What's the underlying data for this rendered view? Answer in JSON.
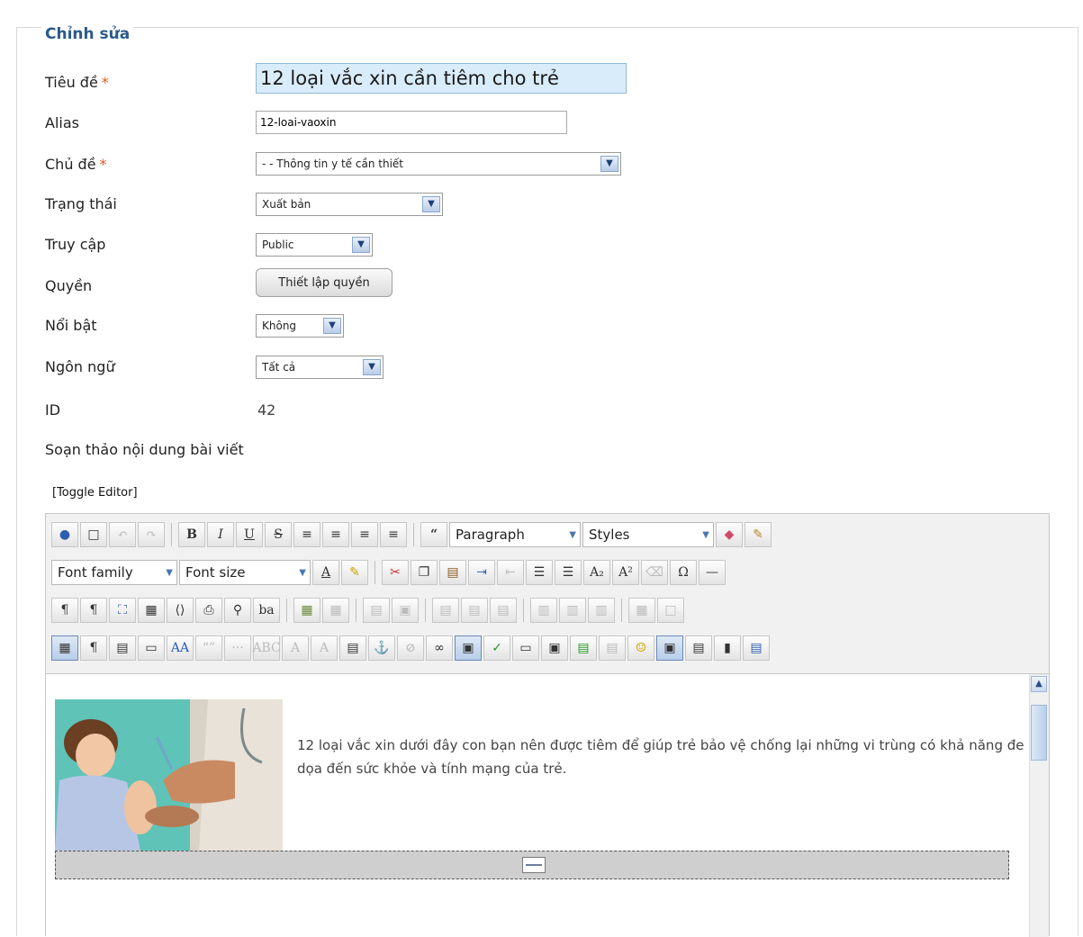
{
  "form": {
    "legend": "Chỉnh sửa",
    "required_mark": "*",
    "title": {
      "label": "Tiêu đề",
      "value": "12 loại vắc xin cần tiêm cho trẻ"
    },
    "alias": {
      "label": "Alias",
      "value": "12-loai-vaoxin"
    },
    "category": {
      "label": "Chủ đề",
      "value": "- - Thông tin y tế cần thiết"
    },
    "state": {
      "label": "Trạng thái",
      "value": "Xuất bản"
    },
    "access": {
      "label": "Truy cập",
      "value": "Public"
    },
    "permissions": {
      "label": "Quyền",
      "button": "Thiết lập quyền"
    },
    "featured": {
      "label": "Nổi bật",
      "value": "Không"
    },
    "language": {
      "label": "Ngôn ngữ",
      "value": "Tất cả"
    },
    "id": {
      "label": "ID",
      "value": "42"
    },
    "content_label": "Soạn thảo nội dung bài viết",
    "toggle_editor": "[Toggle Editor]"
  },
  "editor": {
    "format_combo": "Paragraph",
    "styles_combo": "Styles",
    "font_family_combo": "Font family",
    "font_size_combo": "Font size",
    "content_text": "12 loại vắc xin dưới đây con bạn nên được tiêm để giúp trẻ bảo vệ chống lại những vi trùng có khả năng đe dọa đến sức khỏe và tính mạng của trẻ.",
    "accent_color": "#2a5a8a"
  }
}
